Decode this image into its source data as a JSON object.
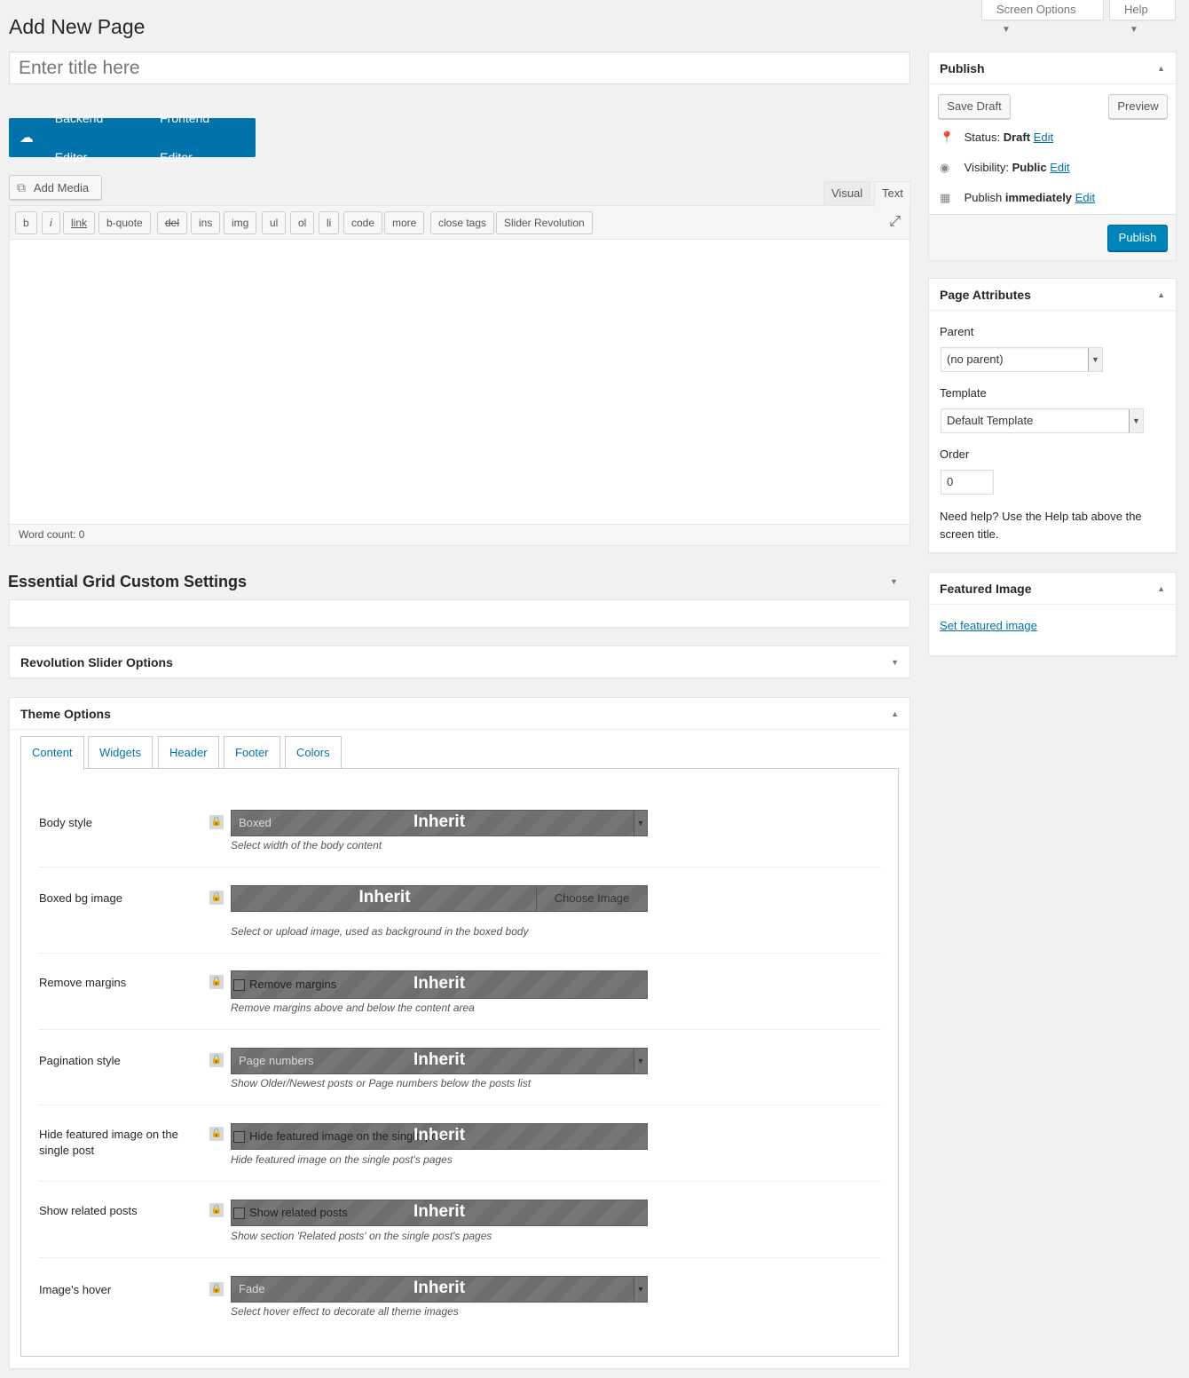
{
  "page_title": "Add New Page",
  "top_tabs": {
    "screen_options": "Screen Options",
    "help": "Help"
  },
  "title_placeholder": "Enter title here",
  "composer": {
    "backend": "Backend Editor",
    "frontend": "Frontend Editor"
  },
  "add_media": "Add Media",
  "editor_tabs": {
    "visual": "Visual",
    "text": "Text"
  },
  "quicktags": [
    "b",
    "i",
    "link",
    "b-quote",
    "del",
    "ins",
    "img",
    "ul",
    "ol",
    "li",
    "code",
    "more",
    "close tags",
    "Slider Revolution"
  ],
  "word_count": "Word count: 0",
  "essential_grid": "Essential Grid Custom Settings",
  "revolution": "Revolution Slider Options",
  "publish": {
    "title": "Publish",
    "save_draft": "Save Draft",
    "preview": "Preview",
    "status_label": "Status:",
    "status_value": "Draft",
    "visibility_label": "Visibility:",
    "visibility_value": "Public",
    "schedule_label": "Publish",
    "schedule_value": "immediately",
    "edit": "Edit",
    "publish_button": "Publish"
  },
  "page_attributes": {
    "title": "Page Attributes",
    "parent_label": "Parent",
    "parent_value": "(no parent)",
    "template_label": "Template",
    "template_value": "Default Template",
    "order_label": "Order",
    "order_value": "0",
    "help_text": "Need help? Use the Help tab above the screen title."
  },
  "featured_image": {
    "title": "Featured Image",
    "link": "Set featured image"
  },
  "theme_options": {
    "title": "Theme Options",
    "tabs": [
      "Content",
      "Widgets",
      "Header",
      "Footer",
      "Colors"
    ],
    "inherit": "Inherit",
    "rows": [
      {
        "label": "Body style",
        "value": "Boxed",
        "desc": "Select width of the body content"
      },
      {
        "label": "Boxed bg image",
        "button": "Choose Image",
        "desc": "Select or upload image, used as background in the boxed body"
      },
      {
        "label": "Remove margins",
        "checkbox": "Remove margins",
        "desc": "Remove margins above and below the content area"
      },
      {
        "label": "Pagination style",
        "value": "Page numbers",
        "desc": "Show Older/Newest posts or Page numbers below the posts list"
      },
      {
        "label": "Hide featured image on the single post",
        "checkbox": "Hide featured image on the single post",
        "desc": "Hide featured image on the single post's pages"
      },
      {
        "label": "Show related posts",
        "checkbox": "Show related posts",
        "desc": "Show section 'Related posts' on the single post's pages"
      },
      {
        "label": "Image's hover",
        "value": "Fade",
        "desc": "Select hover effect to decorate all theme images"
      }
    ]
  }
}
